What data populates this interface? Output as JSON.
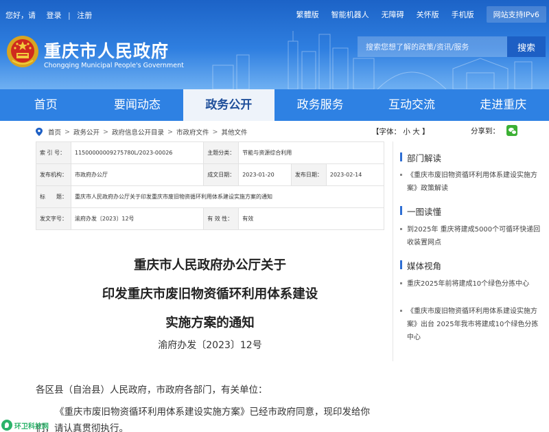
{
  "topbar": {
    "greeting": "您好，请",
    "login": "登录",
    "register": "注册",
    "links": [
      "繁體版",
      "智能机器人",
      "无障碍",
      "关怀版",
      "手机版",
      "网站支持IPv6"
    ]
  },
  "site": {
    "title": "重庆市人民政府",
    "subtitle": "Chongqing Municipal People's Government"
  },
  "search": {
    "placeholder": "搜索您想了解的政策/资讯/服务",
    "button": "搜索"
  },
  "nav": {
    "items": [
      "首页",
      "要闻动态",
      "政务公开",
      "政务服务",
      "互动交流",
      "走进重庆"
    ],
    "active": "政务公开"
  },
  "breadcrumb": {
    "items": [
      "首页",
      "政务公开",
      "政府信息公开目录",
      "市政府文件",
      "其他文件"
    ],
    "separator": ">"
  },
  "font_size": {
    "label": "【字体：",
    "small": "小",
    "large": "大",
    "close": "】"
  },
  "share": {
    "label": "分享到："
  },
  "info": {
    "index_label": "索 引 号：",
    "index_value": "11500000009275780L/2023-00026",
    "topic_label": "主题分类：",
    "topic_value": "节能与资源综合利用",
    "publisher_label": "发布机构：",
    "publisher_value": "市政府办公厅",
    "created_label": "成文日期：",
    "created_value": "2023-01-20",
    "published_label": "发布日期：",
    "published_value": "2023-02-14",
    "subject_label": "标　　题：",
    "subject_value": "重庆市人民政府办公厅关于印发重庆市废旧物资循环利用体系建设实施方案的通知",
    "docno_label": "发文字号：",
    "docno_value": "渝府办发〔2023〕12号",
    "validity_label": "有 效 性：",
    "validity_value": "有效"
  },
  "document": {
    "title_lines": [
      "重庆市人民政府办公厅关于",
      "印发重庆市废旧物资循环利用体系建设",
      "实施方案的通知"
    ],
    "number": "渝府办发〔2023〕12号",
    "salutation": "各区县（自治县）人民政府，市政府各部门，有关单位：",
    "body_line1": "《重庆市废旧物资循环利用体系建设实施方案》已经市政府同意，现印发给你",
    "body_line2": "们，请认真贯彻执行。"
  },
  "sidebar": {
    "sections": [
      {
        "title": "部门解读",
        "items": [
          "《重庆市废旧物资循环利用体系建设实施方案》政策解读"
        ]
      },
      {
        "title": "一图读懂",
        "items": [
          "到2025年 重庆将建成5000个可循环快递回收装置网点"
        ]
      },
      {
        "title": "媒体视角",
        "items": [
          "重庆2025年前将建成10个绿色分拣中心",
          "《重庆市废旧物资循环利用体系建设实施方案》出台 2025年我市将建成10个绿色分拣中心"
        ]
      }
    ]
  },
  "watermark": {
    "text": "环卫科技网"
  },
  "colors": {
    "header_blue": "#1c63c7",
    "nav_blue": "#2e81e3",
    "accent": "#2e6ed4",
    "wechat_green": "#3cb034"
  }
}
